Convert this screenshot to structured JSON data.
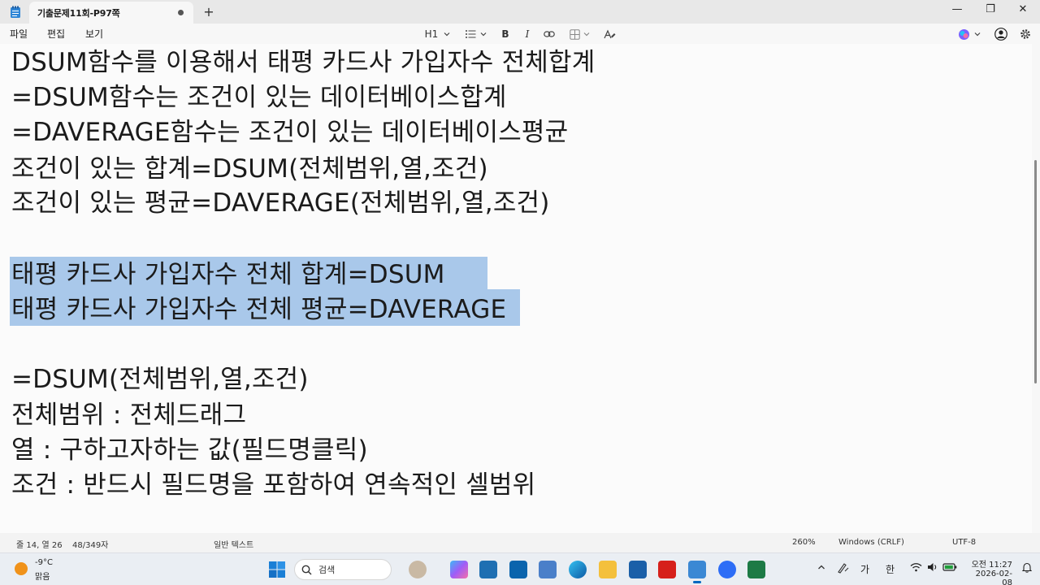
{
  "window": {
    "tab_title": "기출문제11회-P97쪽",
    "new_tab": "+",
    "minimize": "—",
    "maximize": "❐",
    "close": "✕"
  },
  "menu": {
    "file": "파일",
    "edit": "편집",
    "view": "보기",
    "heading": "H1",
    "bold": "B",
    "italic": "I"
  },
  "editor": {
    "lines": [
      "DSUM함수를 이용해서 태평 카드사 가입자수 전체합계",
      "=DSUM함수는 조건이 있는 데이터베이스합계",
      "=DAVERAGE함수는 조건이 있는 데이터베이스평균",
      "조건이 있는 합계=DSUM(전체범위,열,조건)",
      "조건이 있는 평균=DAVERAGE(전체범위,열,조건)",
      "",
      "태평 카드사 가입자수 전체 합계=DSUM",
      "태평 카드사 가입자수 전체 평균=DAVERAGE",
      "",
      "=DSUM(전체범위,열,조건)",
      "전체범위 : 전체드래그",
      "열 : 구하고자하는 값(필드명클릭)",
      "조건 : 반드시 필드명을 포함하여 연속적인 셀범위"
    ],
    "selection_color": "#a9c8ea"
  },
  "status": {
    "position": "줄 14, 열 26",
    "char_count": "48/349자",
    "format": "일반 텍스트",
    "zoom": "260%",
    "line_ending": "Windows (CRLF)",
    "encoding": "UTF-8"
  },
  "taskbar": {
    "weather_temp": "-9°C",
    "weather_cond": "맑음",
    "search_label": "검색",
    "ime_mode": "가",
    "ime_lang": "한",
    "time": "오전 11:27",
    "date": "2026-02-08"
  },
  "colors": {
    "accent": "#0067c0",
    "selection": "#a9c8ea"
  }
}
